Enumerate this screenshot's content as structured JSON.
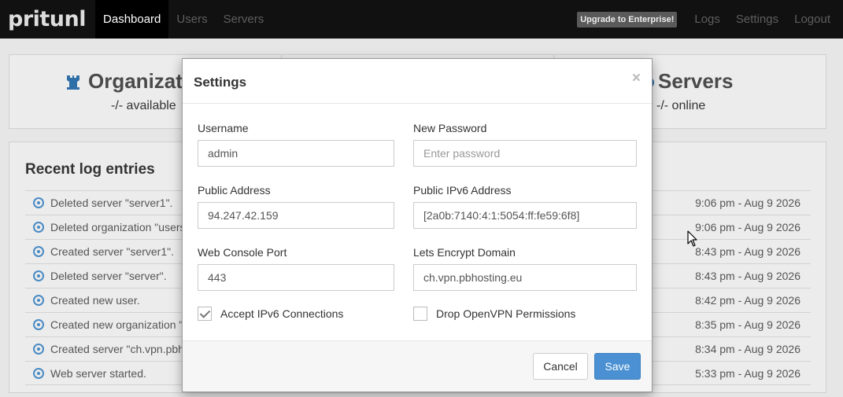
{
  "navbar": {
    "brand": "pritunl",
    "items": [
      "Dashboard",
      "Users",
      "Servers"
    ],
    "upgrade": "Upgrade to Enterprise!",
    "right_items": [
      "Logs",
      "Settings",
      "Logout"
    ]
  },
  "stats": {
    "organizations": {
      "title": "Organizat",
      "sub": "-/- available"
    },
    "servers": {
      "title": "Servers",
      "sub": "-/- online"
    }
  },
  "logs": {
    "title": "Recent log entries",
    "entries": [
      {
        "text": "Deleted server \"server1\".",
        "time": "9:06 pm - Aug 9 2026"
      },
      {
        "text": "Deleted organization \"users",
        "time": "9:06 pm - Aug 9 2026"
      },
      {
        "text": "Created server \"server1\".",
        "time": "8:43 pm - Aug 9 2026"
      },
      {
        "text": "Deleted server \"server\".",
        "time": "8:43 pm - Aug 9 2026"
      },
      {
        "text": "Created new user.",
        "time": "8:42 pm - Aug 9 2026"
      },
      {
        "text": "Created new organization \"",
        "time": "8:35 pm - Aug 9 2026"
      },
      {
        "text": "Created server \"ch.vpn.pbh",
        "time": "8:34 pm - Aug 9 2026"
      },
      {
        "text": "Web server started.",
        "time": "5:33 pm - Aug 9 2026"
      }
    ]
  },
  "modal": {
    "title": "Settings",
    "close": "×",
    "username": {
      "label": "Username",
      "value": "admin"
    },
    "new_password": {
      "label": "New Password",
      "placeholder": "Enter password"
    },
    "public_address": {
      "label": "Public Address",
      "value": "94.247.42.159"
    },
    "public_ipv6": {
      "label": "Public IPv6 Address",
      "value": "[2a0b:7140:4:1:5054:ff:fe59:6f8]"
    },
    "web_console_port": {
      "label": "Web Console Port",
      "value": "443"
    },
    "lets_encrypt": {
      "label": "Lets Encrypt Domain",
      "value": "ch.vpn.pbhosting.eu"
    },
    "accept_ipv6": {
      "label": "Accept IPv6 Connections",
      "checked": true
    },
    "drop_openvpn": {
      "label": "Drop OpenVPN Permissions",
      "checked": false
    },
    "cancel_label": "Cancel",
    "save_label": "Save"
  },
  "colors": {
    "accent": "#4a90d2",
    "navbar": "#111111"
  }
}
